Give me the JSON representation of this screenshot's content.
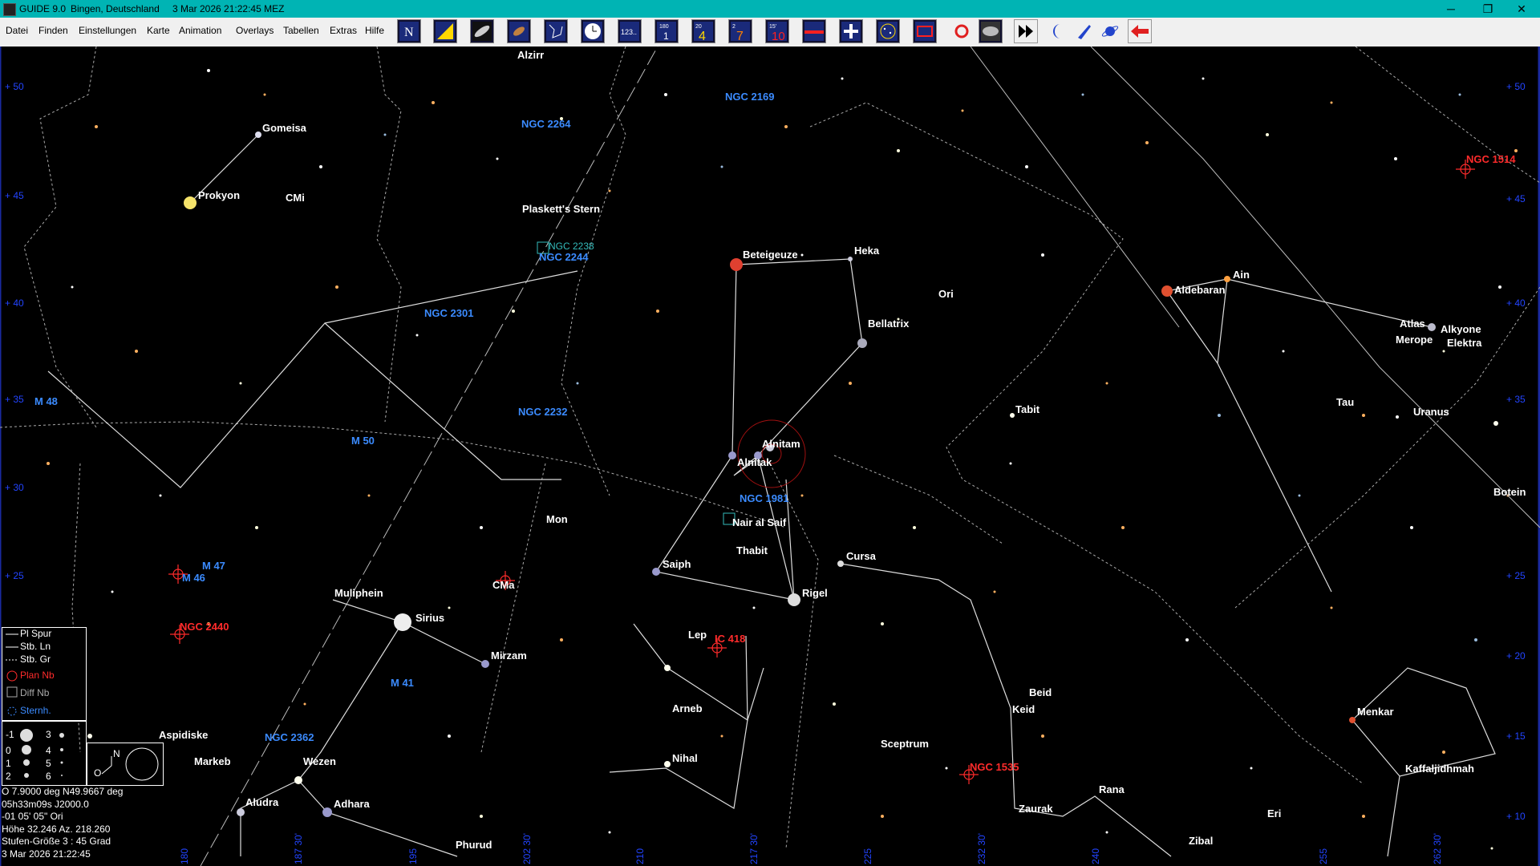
{
  "window": {
    "app_title": "GUIDE 9.0",
    "location": "Bingen, Deutschland",
    "datetime": "3 Mar 2026 21:22:45 MEZ",
    "minimize": "─",
    "maximize": "❐",
    "close": "✕"
  },
  "menu": [
    "Datei",
    "Finden",
    "Einstellungen",
    "Karte",
    "Animation",
    "Overlays",
    "Tabellen",
    "Extras",
    "Hilfe"
  ],
  "toolbar_icons": [
    "north-icon",
    "comet-icon",
    "galaxy-icon",
    "asteroid-icon",
    "constellation-icon",
    "clock-icon",
    "numbers-icon",
    "rotate-180-icon",
    "calendar-20-icon",
    "calendar-7-icon",
    "timestep-15-icon",
    "horizon-icon",
    "cross-icon",
    "starfield-icon",
    "milkyway-icon",
    "red-circle-icon",
    "dss-image-icon",
    "fast-forward-icon",
    "moon-icon",
    "scope-icon",
    "planet-icon",
    "back-arrow-icon"
  ],
  "sky": {
    "ra_ticks_left": [
      "+ 50",
      "+ 45",
      "+ 40",
      "+ 35",
      "+ 30",
      "+ 25",
      "+ 20",
      "+ 15",
      "+ 10"
    ],
    "ra_ticks_right": [
      "+ 50",
      "+ 45",
      "+ 40",
      "+ 35",
      "+ 30",
      "+ 25",
      "+ 20",
      "+ 15",
      "+ 10"
    ],
    "az_ticks": [
      "180",
      "187 30'",
      "195",
      "202 30'",
      "210",
      "217 30'",
      "225",
      "232 30'",
      "240",
      "255",
      "262 30'"
    ],
    "star_labels": [
      "Alzirr",
      "Gomeisa",
      "Prokyon",
      "CMi",
      "Plaskett's Stern",
      "Beteigeuze",
      "Heka",
      "Ori",
      "Bellatrix",
      "Aldebaran",
      "Ain",
      "Atlas",
      "Alkyone",
      "Merope",
      "Elektra",
      "Tau",
      "Uranus",
      "Tabit",
      "Alnitam",
      "Alnitak",
      "Mon",
      "Nair al Saif",
      "Thabit",
      "Saiph",
      "Rigel",
      "Cursa",
      "Botein",
      "Muliphein",
      "CMa",
      "Sirius",
      "Mirzam",
      "Lep",
      "Arneb",
      "Nihal",
      "Beid",
      "Keid",
      "Menkar",
      "Kaffaljidhmah",
      "Aspidiske",
      "Markeb",
      "Wezen",
      "Sceptrum",
      "Aludra",
      "Adhara",
      "Phurud",
      "Rana",
      "Zaurak",
      "Zibal",
      "Eri"
    ],
    "deepsky_blue": [
      "NGC 2169",
      "NGC 2264",
      "NGC 2244",
      "NGC 2301",
      "M 48",
      "M 50",
      "NGC 2232",
      "NGC 1981",
      "M 47",
      "M 46",
      "M 41",
      "NGC 2362"
    ],
    "deepsky_red": [
      "NGC 1514",
      "NGC 2440",
      "IC 418",
      "NGC 1535"
    ],
    "deepsky_green": [
      "NGC 2238"
    ]
  },
  "legend": {
    "items": [
      "Pl Spur",
      "Stb. Ln",
      "Stb. Gr",
      "Plan Nb",
      "Diff Nb",
      "Sternh."
    ],
    "mags": [
      "-1",
      "0",
      "1",
      "2",
      "3",
      "4",
      "5",
      "6"
    ],
    "compass_n": "N",
    "compass_o": "O"
  },
  "info": {
    "line1": "O  7.9000 deg N49.9667 deg",
    "line2": "05h33m09s   J2000.0",
    "line3": "-01 05' 05\"      Ori",
    "line4": "Höhe 32.246   Az. 218.260",
    "line5": "Stufen-Größe 3 : 45 Grad",
    "line6": "3 Mar 2026 21:22:45"
  },
  "colors": {
    "titlebar": "#00b4b4",
    "menubar": "#f0f0f0",
    "sky": "#000000",
    "deepsky_blue": "#3b8bff",
    "deepsky_red": "#ff2b2b"
  }
}
